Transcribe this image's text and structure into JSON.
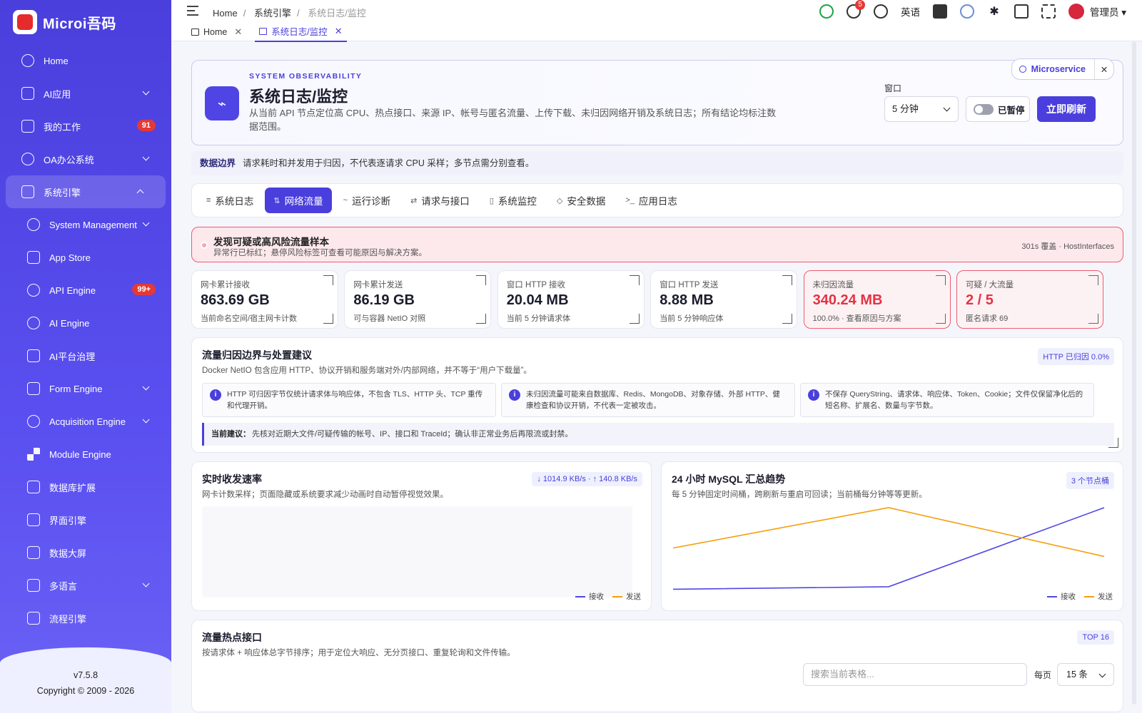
{
  "app": {
    "name": "Microi吾码",
    "version": "v7.5.8",
    "copyright": "Copyright © 2009 - 2026"
  },
  "sidebar": {
    "items": [
      {
        "label": "Home",
        "icon": "home-icon"
      },
      {
        "label": "AI应用",
        "icon": "document-icon",
        "expandable": true
      },
      {
        "label": "我的工作",
        "icon": "document-icon",
        "badge": "91"
      },
      {
        "label": "OA办公系统",
        "icon": "home-icon",
        "expandable": true
      },
      {
        "label": "系统引擎",
        "icon": "chip-icon",
        "expanded": true,
        "active": true
      },
      {
        "label": "System Management",
        "icon": "gear-icon",
        "expandable": true,
        "sub": true
      },
      {
        "label": "App Store",
        "icon": "bag-icon",
        "sub": true
      },
      {
        "label": "API Engine",
        "icon": "link-icon",
        "badge": "99+",
        "sub": true
      },
      {
        "label": "AI Engine",
        "icon": "chat-icon",
        "sub": true
      },
      {
        "label": "AI平台治理",
        "icon": "clipboard-icon",
        "sub": true
      },
      {
        "label": "Form Engine",
        "icon": "document-icon",
        "expandable": true,
        "sub": true
      },
      {
        "label": "Acquisition Engine",
        "icon": "target-icon",
        "expandable": true,
        "sub": true
      },
      {
        "label": "Module Engine",
        "icon": "grid-icon",
        "sub": true
      },
      {
        "label": "数据库扩展",
        "icon": "database-icon",
        "sub": true
      },
      {
        "label": "界面引擎",
        "icon": "brush-icon",
        "sub": true
      },
      {
        "label": "数据大屏",
        "icon": "screen-icon",
        "sub": true
      },
      {
        "label": "多语言",
        "icon": "message-icon",
        "expandable": true,
        "sub": true
      },
      {
        "label": "流程引擎",
        "icon": "share-icon",
        "sub": true
      }
    ]
  },
  "header": {
    "breadcrumb": [
      "Home",
      "系统引擎",
      "系统日志/监控"
    ],
    "tabs": [
      {
        "label": "Home"
      },
      {
        "label": "系统日志/监控",
        "active": true
      }
    ],
    "notifications": "5",
    "language": "英语",
    "user": "管理员"
  },
  "hero": {
    "kicker": "SYSTEM OBSERVABILITY",
    "title": "系统日志/监控",
    "desc": "从当前 API 节点定位高 CPU、热点接口、来源 IP、帐号与匿名流量、上传下载、未归因网络开销及系统日志；所有结论均标注数据范围。",
    "service": "Microservice",
    "window_label": "窗口",
    "window_value": "5 分钟",
    "pause_label": "已暂停",
    "refresh_label": "立即刷新"
  },
  "boundary": {
    "title": "数据边界",
    "text": "请求耗时和并发用于归因，不代表逐请求 CPU 采样；多节点需分别查看。"
  },
  "tabs": [
    {
      "label": "系统日志",
      "icon": "≡"
    },
    {
      "label": "网络流量",
      "icon": "⇅",
      "active": true
    },
    {
      "label": "运行诊断",
      "icon": "~"
    },
    {
      "label": "请求与接口",
      "icon": "⇄"
    },
    {
      "label": "系统监控",
      "icon": "▯"
    },
    {
      "label": "安全数据",
      "icon": "◇"
    },
    {
      "label": "应用日志",
      "icon": ">_"
    }
  ],
  "alert": {
    "title": "发现可疑或高风险流量样本",
    "sub": "异常行已标红；悬停风险标签可查看可能原因与解决方案。",
    "right": "301s 覆盖 · HostInterfaces"
  },
  "stats": [
    {
      "label": "网卡累计接收",
      "value": "863.69 GB",
      "sub": "当前命名空间/宿主网卡计数"
    },
    {
      "label": "网卡累计发送",
      "value": "86.19 GB",
      "sub": "可与容器 NetIO 对照"
    },
    {
      "label": "窗口 HTTP 接收",
      "value": "20.04 MB",
      "sub": "当前 5 分钟请求体"
    },
    {
      "label": "窗口 HTTP 发送",
      "value": "8.88 MB",
      "sub": "当前 5 分钟响应体"
    },
    {
      "label": "未归因流量",
      "value": "340.24 MB",
      "sub": "100.0% · 查看原因与方案",
      "alert": true
    },
    {
      "label": "可疑 / 大流量",
      "value": "2 / 5",
      "sub": "匿名请求 69",
      "alert": true
    }
  ],
  "flow": {
    "title": "流量归因边界与处置建议",
    "sub": "Docker NetIO 包含应用 HTTP、协议开销和服务端对外/内部网络，并不等于“用户下载量”。",
    "pill": "HTTP 已归因 0.0%",
    "notes": [
      "HTTP 可归因字节仅统计请求体与响应体，不包含 TLS、HTTP 头、TCP 重传和代理开销。",
      "未归因流量可能来自数据库、Redis、MongoDB、对象存储、外部 HTTP、健康检查和协议开销，不代表一定被攻击。",
      "不保存 QueryString、请求体、响应体、Token、Cookie；文件仅保留净化后的短名称、扩展名、数量与字节数。"
    ],
    "advice_label": "当前建议：",
    "advice": "先核对近期大文件/可疑传输的帐号、IP、接口和 TraceId；确认非正常业务后再限流或封禁。"
  },
  "colors": {
    "accent": "#4a3fdc",
    "receive": "#4f46e5",
    "send": "#f59e0b",
    "danger": "#e53244"
  },
  "realtime": {
    "title": "实时收发速率",
    "sub": "网卡计数采样；页面隐藏或系统要求减少动画时自动暂停视觉效果。",
    "pill": "↓ 1014.9 KB/s · ↑ 140.8 KB/s",
    "legend": [
      "接收",
      "发送"
    ]
  },
  "chart_data": {
    "type": "line",
    "title": "24 小时 MySQL 汇总趋势",
    "subtitle": "每 5 分钟固定时间桶，跨刷新与重启可回读；当前桶每分钟等等更新。",
    "badge": "3 个节点桶",
    "x": [
      1,
      2,
      3
    ],
    "series": [
      {
        "name": "接收",
        "values": [
          0.03,
          0.06,
          1.0
        ]
      },
      {
        "name": "发送",
        "values": [
          0.52,
          1.0,
          0.42
        ]
      }
    ],
    "ylim": [
      0,
      1
    ],
    "grid": false,
    "legend": "bottom-right"
  },
  "hotspot": {
    "title": "流量热点接口",
    "sub": "按请求体 + 响应体总字节排序；用于定位大响应、无分页接口、重复轮询和文件传输。",
    "pill": "TOP 16",
    "search_placeholder": "搜索当前表格...",
    "per_label": "每页",
    "per_value": "15 条"
  }
}
